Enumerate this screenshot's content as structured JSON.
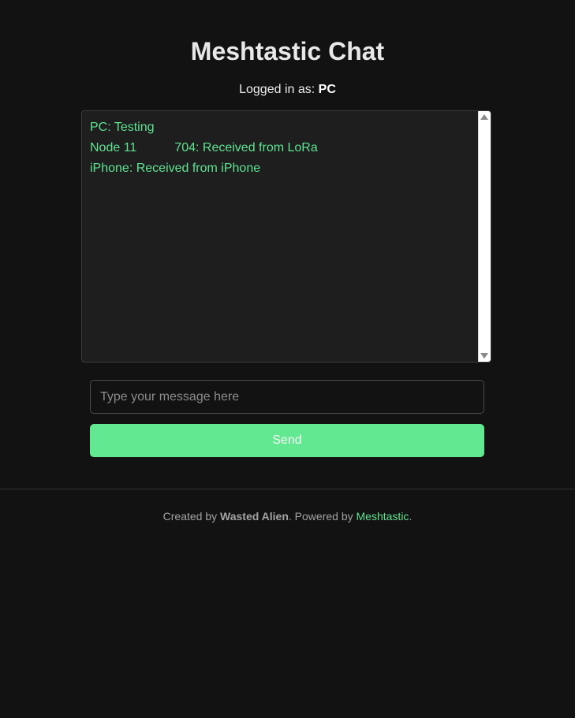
{
  "header": {
    "title": "Meshtastic Chat",
    "login_prefix": "Logged in as:",
    "username": "PC"
  },
  "chat": {
    "messages": [
      {
        "text": "PC: Testing"
      },
      {
        "text_before": "Node 11",
        "text_after": "704: Received from LoRa"
      },
      {
        "text": "iPhone: Received from iPhone"
      }
    ]
  },
  "compose": {
    "placeholder": "Type your message here",
    "value": "",
    "send_label": "Send"
  },
  "footer": {
    "created_by_prefix": "Created by",
    "author": "Wasted Alien",
    "powered_by_prefix": ". Powered by",
    "powered_by_link": "Meshtastic",
    "suffix": "."
  },
  "colors": {
    "background": "#121212",
    "accent": "#63e892",
    "message_text": "#5fe391",
    "chat_background": "#1e1e1e"
  }
}
